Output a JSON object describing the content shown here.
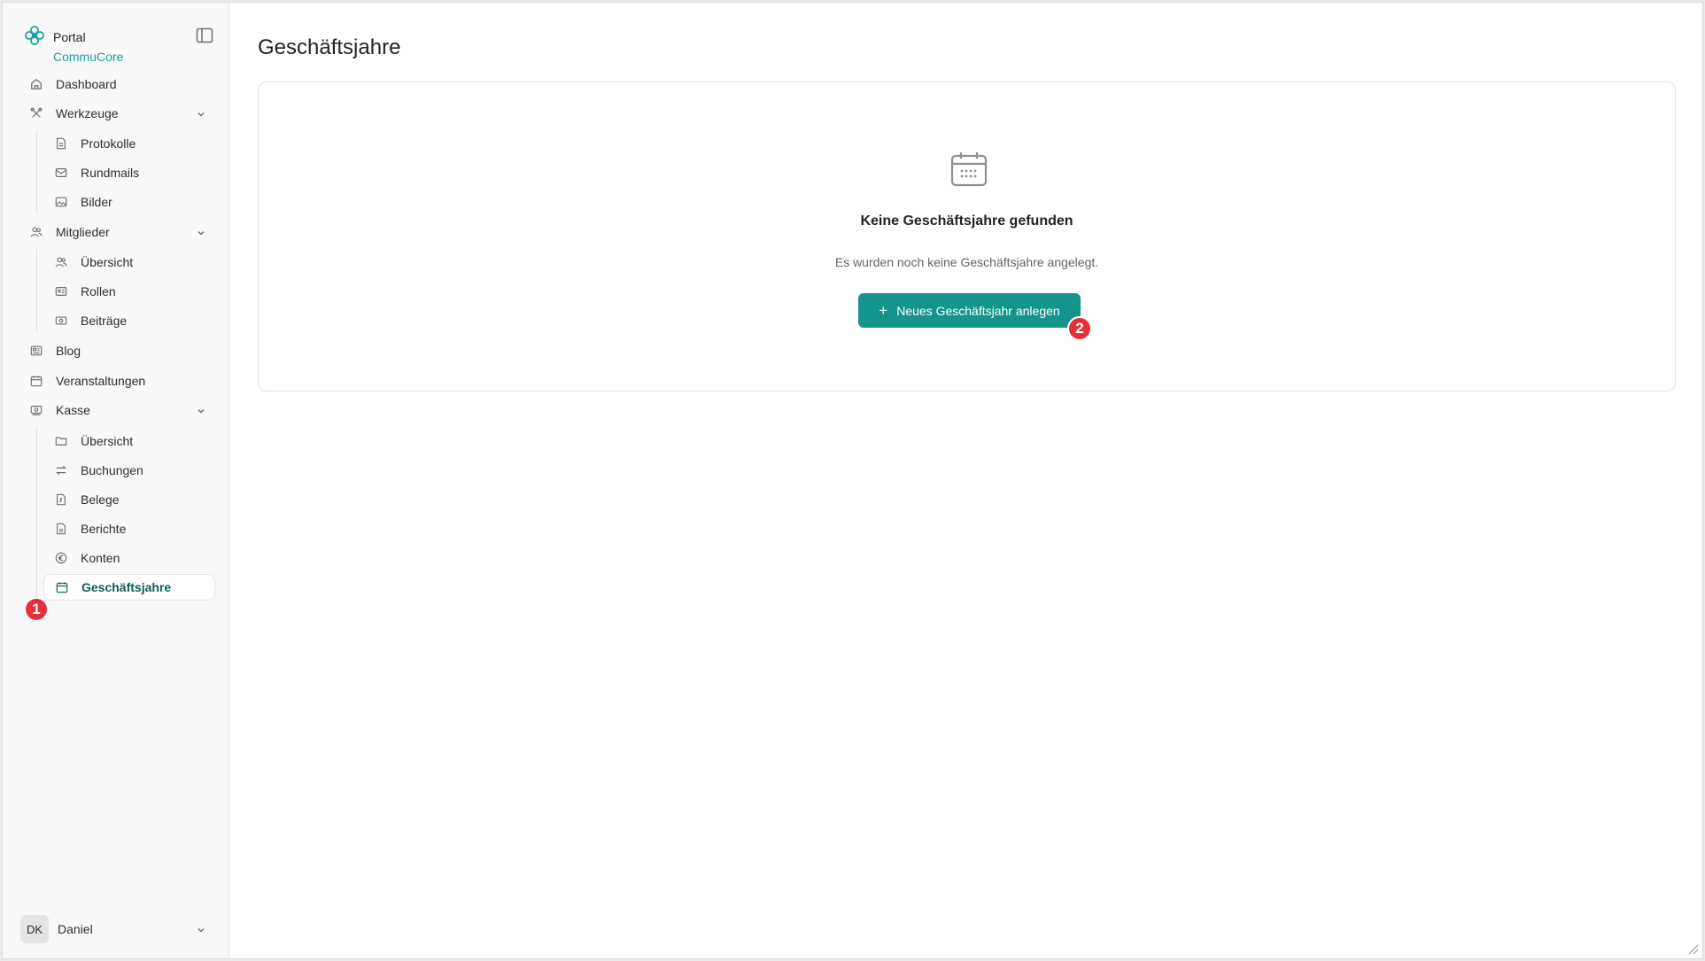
{
  "brand": {
    "title": "Portal",
    "subtitle": "CommuCore",
    "logo_icon": "flower-logo-icon",
    "accent_color": "#14a39a"
  },
  "sidebar": {
    "toggle_icon": "sidebar-toggle-icon",
    "items": [
      {
        "label": "Dashboard",
        "icon": "home-icon"
      },
      {
        "label": "Werkzeuge",
        "icon": "tools-icon",
        "expanded": true,
        "children": [
          {
            "label": "Protokolle",
            "icon": "file-text-icon"
          },
          {
            "label": "Rundmails",
            "icon": "mail-icon"
          },
          {
            "label": "Bilder",
            "icon": "image-icon"
          }
        ]
      },
      {
        "label": "Mitglieder",
        "icon": "users-icon",
        "expanded": true,
        "children": [
          {
            "label": "Übersicht",
            "icon": "users-icon"
          },
          {
            "label": "Rollen",
            "icon": "id-card-icon"
          },
          {
            "label": "Beiträge",
            "icon": "banknote-icon"
          }
        ]
      },
      {
        "label": "Blog",
        "icon": "newspaper-icon"
      },
      {
        "label": "Veranstaltungen",
        "icon": "calendar-icon"
      },
      {
        "label": "Kasse",
        "icon": "cash-icon",
        "expanded": true,
        "children": [
          {
            "label": "Übersicht",
            "icon": "folder-icon"
          },
          {
            "label": "Buchungen",
            "icon": "arrows-icon"
          },
          {
            "label": "Belege",
            "icon": "receipt-icon"
          },
          {
            "label": "Berichte",
            "icon": "file-icon"
          },
          {
            "label": "Konten",
            "icon": "euro-icon"
          },
          {
            "label": "Geschäftsjahre",
            "icon": "calendar-icon",
            "active": true
          }
        ]
      }
    ]
  },
  "user": {
    "initials": "DK",
    "name": "Daniel"
  },
  "main": {
    "title": "Geschäftsjahre",
    "empty_state": {
      "icon": "calendar-icon",
      "title": "Keine Geschäftsjahre gefunden",
      "description": "Es wurden noch keine Geschäftsjahre angelegt.",
      "button_label": "Neues Geschäftsjahr anlegen",
      "button_color": "#15948b"
    }
  },
  "annotations": {
    "badge_1": "1",
    "badge_2": "2",
    "badge_color": "#e4303b"
  }
}
